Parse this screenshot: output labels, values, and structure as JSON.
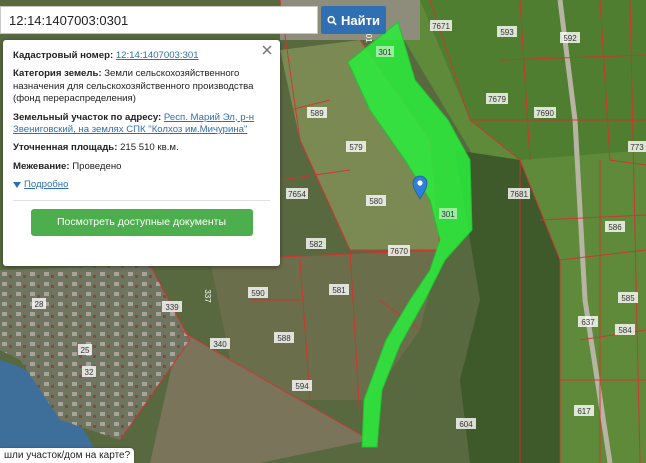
{
  "search": {
    "value": "12:14:1407003:0301",
    "button_label": "Найти"
  },
  "info_panel": {
    "cadastral_label": "Кадастровый номер:",
    "cadastral_value": "12:14:1407003:301",
    "category_label": "Категория земель:",
    "category_value": "Земли сельскохозяйственного назначения для сельскохозяйственного производства (фонд перераспределения)",
    "address_label": "Земельный участок по адресу:",
    "address_value": "Респ. Марий Эл, р-н Звениговский, на землях СПК \"Колхоз им.Мичурина\"",
    "area_label": "Уточненная площадь:",
    "area_value": "215 510 кв.м.",
    "survey_label": "Межевание:",
    "survey_value": "Проведено",
    "more_link": "Подробно",
    "docs_button": "Посмотреть доступные документы"
  },
  "bottom_prompt": "шли участок/дом на карте?",
  "map": {
    "highlight_color": "#2bea3c",
    "marker_color": "#2f7fd8",
    "parcel_line_color": "#d93030",
    "parcel_labels": [
      "7671",
      "593",
      "592",
      "301",
      "7679",
      "7690",
      "589",
      "579",
      "773",
      "580",
      "7681",
      "301",
      "7654",
      "586",
      "582",
      "7670",
      "590",
      "581",
      "339",
      "337",
      "585",
      "637",
      "340",
      "584",
      "588",
      "594",
      "617",
      "604",
      "28",
      "25",
      "32",
      "301"
    ]
  }
}
